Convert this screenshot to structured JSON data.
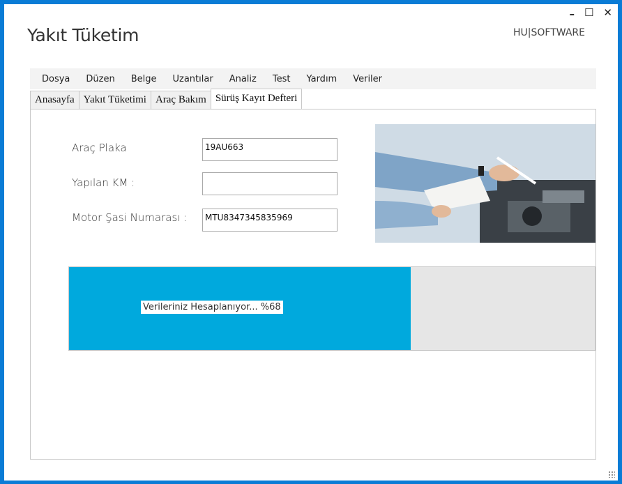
{
  "window": {
    "title": "Yakıt Tüketim",
    "brand": "HU|SOFTWARE",
    "controls": {
      "minimize": "–",
      "maximize": "☐",
      "close": "✕"
    }
  },
  "menu": [
    "Dosya",
    "Düzen",
    "Belge",
    "Uzantılar",
    "Analiz",
    "Test",
    "Yardım",
    "Veriler"
  ],
  "tabs": {
    "items": [
      "Anasayfa",
      "Yakıt Tüketimi",
      "Araç Bakım",
      "Sürüş Kayıt Defteri"
    ],
    "active": "Sürüş Kayıt Defteri"
  },
  "form": {
    "plate_label": "Araç Plaka",
    "plate_value": "19AU663",
    "km_label": "Yapılan KM :",
    "km_value": "",
    "chassis_label": "Motor Şasi Numarası :",
    "chassis_value": "MTU8347345835969"
  },
  "progress": {
    "text": "Verileriniz Hesaplanıyor... %68",
    "percent": 65,
    "fill_color": "#00a9dd",
    "track_color": "#e6e6e6"
  },
  "colors": {
    "frame": "#0a7cd6"
  }
}
